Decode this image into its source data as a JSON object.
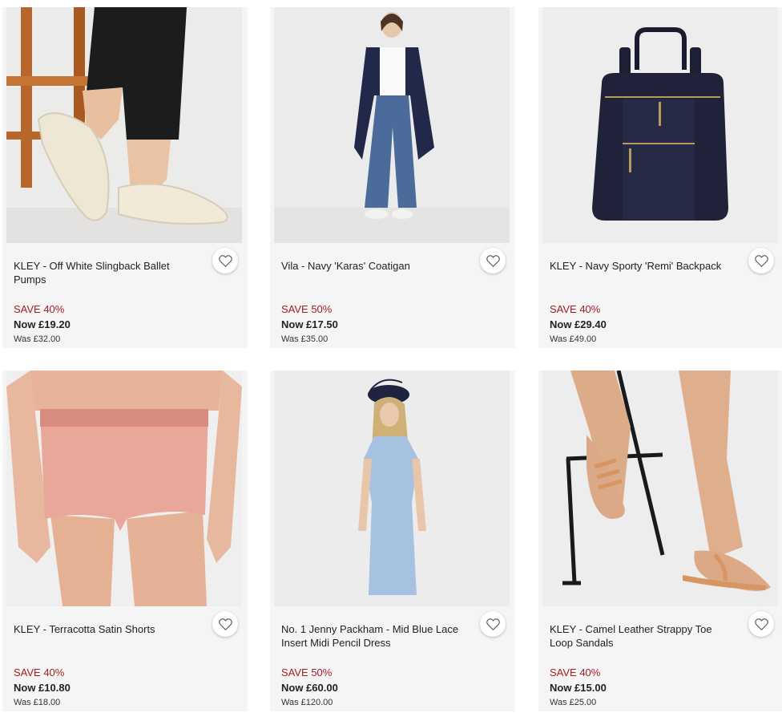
{
  "products": [
    {
      "title": "KLEY - Off White Slingback Ballet Pumps",
      "save": "SAVE 40%",
      "now": "Now £19.20",
      "was": "Was £32.00",
      "image": "off-white-slingback-pumps"
    },
    {
      "title": "Vila - Navy 'Karas' Coatigan",
      "save": "SAVE 50%",
      "now": "Now £17.50",
      "was": "Was £35.00",
      "image": "navy-coatigan"
    },
    {
      "title": "KLEY - Navy Sporty 'Remi' Backpack",
      "save": "SAVE 40%",
      "now": "Now £29.40",
      "was": "Was £49.00",
      "image": "navy-backpack"
    },
    {
      "title": "KLEY - Terracotta Satin Shorts",
      "save": "SAVE 40%",
      "now": "Now £10.80",
      "was": "Was £18.00",
      "image": "terracotta-shorts"
    },
    {
      "title": "No. 1 Jenny Packham - Mid Blue Lace Insert Midi Pencil Dress",
      "save": "SAVE 50%",
      "now": "Now £60.00",
      "was": "Was £120.00",
      "image": "mid-blue-dress"
    },
    {
      "title": "KLEY - Camel Leather Strappy Toe Loop Sandals",
      "save": "SAVE 40%",
      "now": "Now £15.00",
      "was": "Was £25.00",
      "image": "camel-sandals"
    }
  ],
  "colors": {
    "sale_red": "#a31d24",
    "card_bg": "#f5f5f5"
  },
  "icons": {
    "favourite": "heart-outline-icon"
  }
}
